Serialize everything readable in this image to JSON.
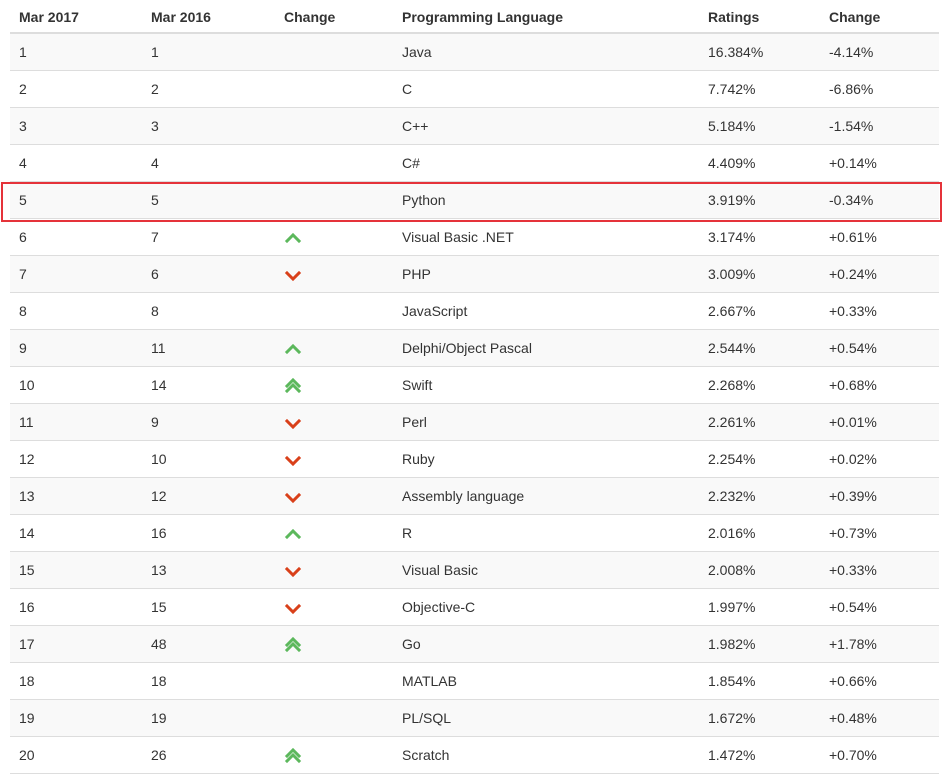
{
  "colors": {
    "up": "#5cb85c",
    "down": "#d9401a",
    "highlight": "#e5333a"
  },
  "headers": [
    "Mar 2017",
    "Mar 2016",
    "Change",
    "Programming Language",
    "Ratings",
    "Change"
  ],
  "rows": [
    {
      "rank": "1",
      "prev": "1",
      "trend": "none",
      "language": "Java",
      "rating": "16.384%",
      "change": "-4.14%"
    },
    {
      "rank": "2",
      "prev": "2",
      "trend": "none",
      "language": "C",
      "rating": "7.742%",
      "change": "-6.86%"
    },
    {
      "rank": "3",
      "prev": "3",
      "trend": "none",
      "language": "C++",
      "rating": "5.184%",
      "change": "-1.54%"
    },
    {
      "rank": "4",
      "prev": "4",
      "trend": "none",
      "language": "C#",
      "rating": "4.409%",
      "change": "+0.14%"
    },
    {
      "rank": "5",
      "prev": "5",
      "trend": "none",
      "language": "Python",
      "rating": "3.919%",
      "change": "-0.34%"
    },
    {
      "rank": "6",
      "prev": "7",
      "trend": "up",
      "language": "Visual Basic .NET",
      "rating": "3.174%",
      "change": "+0.61%"
    },
    {
      "rank": "7",
      "prev": "6",
      "trend": "down",
      "language": "PHP",
      "rating": "3.009%",
      "change": "+0.24%"
    },
    {
      "rank": "8",
      "prev": "8",
      "trend": "none",
      "language": "JavaScript",
      "rating": "2.667%",
      "change": "+0.33%"
    },
    {
      "rank": "9",
      "prev": "11",
      "trend": "up",
      "language": "Delphi/Object Pascal",
      "rating": "2.544%",
      "change": "+0.54%"
    },
    {
      "rank": "10",
      "prev": "14",
      "trend": "up-double",
      "language": "Swift",
      "rating": "2.268%",
      "change": "+0.68%"
    },
    {
      "rank": "11",
      "prev": "9",
      "trend": "down",
      "language": "Perl",
      "rating": "2.261%",
      "change": "+0.01%"
    },
    {
      "rank": "12",
      "prev": "10",
      "trend": "down",
      "language": "Ruby",
      "rating": "2.254%",
      "change": "+0.02%"
    },
    {
      "rank": "13",
      "prev": "12",
      "trend": "down",
      "language": "Assembly language",
      "rating": "2.232%",
      "change": "+0.39%"
    },
    {
      "rank": "14",
      "prev": "16",
      "trend": "up",
      "language": "R",
      "rating": "2.016%",
      "change": "+0.73%"
    },
    {
      "rank": "15",
      "prev": "13",
      "trend": "down",
      "language": "Visual Basic",
      "rating": "2.008%",
      "change": "+0.33%"
    },
    {
      "rank": "16",
      "prev": "15",
      "trend": "down",
      "language": "Objective-C",
      "rating": "1.997%",
      "change": "+0.54%"
    },
    {
      "rank": "17",
      "prev": "48",
      "trend": "up-double",
      "language": "Go",
      "rating": "1.982%",
      "change": "+1.78%"
    },
    {
      "rank": "18",
      "prev": "18",
      "trend": "none",
      "language": "MATLAB",
      "rating": "1.854%",
      "change": "+0.66%"
    },
    {
      "rank": "19",
      "prev": "19",
      "trend": "none",
      "language": "PL/SQL",
      "rating": "1.672%",
      "change": "+0.48%"
    },
    {
      "rank": "20",
      "prev": "26",
      "trend": "up-double",
      "language": "Scratch",
      "rating": "1.472%",
      "change": "+0.70%"
    }
  ],
  "highlighted_rank": "5"
}
